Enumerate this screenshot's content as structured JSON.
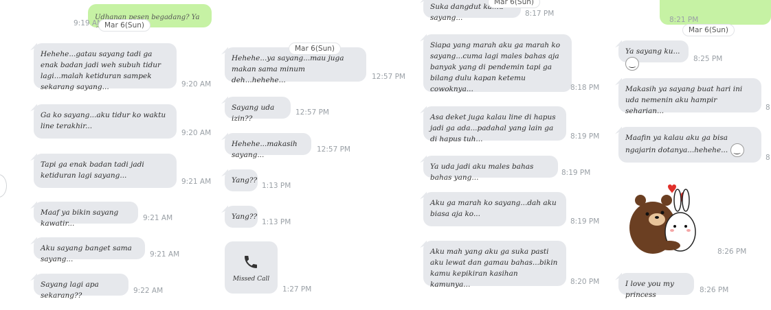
{
  "columns": [
    {
      "top_fragment": {
        "text": "Udhanan pesen begadang? Ya ga?",
        "time": "9:19 AM"
      },
      "date": "Mar 6(Sun)",
      "messages": [
        {
          "text": "Hehehe...gatau sayang tadi ga enak badan jadi weh subuh tidur lagi...malah ketiduran sampek sekarang sayang...",
          "time": "9:20 AM"
        },
        {
          "text": "Ga ko sayang...aku tidur ko waktu line terakhir...",
          "time": "9:20 AM"
        },
        {
          "text": "Tapi ga enak badan tadi jadi ketiduran lagi sayang...",
          "time": "9:21 AM"
        },
        {
          "text": "Maaf ya bikin sayang kawatir...",
          "time": "9:21 AM"
        },
        {
          "text": "Aku sayang banget sama sayang...",
          "time": "9:21 AM"
        },
        {
          "text": "Sayang lagi apa sekarang??",
          "time": "9:22 AM"
        }
      ]
    },
    {
      "date": "Mar 6(Sun)",
      "messages": [
        {
          "text": "Hehehe...ya sayang...mau juga makan sama minum deh...hehehe...",
          "time": "12:57 PM"
        },
        {
          "text": "Sayang uda izin??",
          "time": "12:57 PM"
        },
        {
          "text": "Hehehe...makasih sayang...",
          "time": "12:57 PM"
        },
        {
          "text": "Yang??",
          "time": "1:13 PM"
        },
        {
          "text": "Yang??",
          "time": "1:13 PM"
        }
      ],
      "missed_call": {
        "icon": "phone-icon",
        "label": "Missed Call",
        "time": "1:27 PM"
      }
    },
    {
      "date": "Mar 6(Sun)",
      "messages": [
        {
          "text": "Suka dangdut kamu sayang...",
          "time": "8:17 PM"
        },
        {
          "text": "Siapa yang marah aku ga marah ko sayang...cuma lagi males bahas aja banyak yang di pendemin tapi ga bilang dulu kapan ketemu cowoknya...",
          "time": "8:18 PM"
        },
        {
          "text": "Asa deket juga kalau line di hapus jadi ga ada...padahal yang lain ga di hapus tuh...",
          "time": "8:19 PM"
        },
        {
          "text": "Ya uda jadi aku males bahas bahas yang...",
          "time": "8:19 PM"
        },
        {
          "text": "Aku ga marah ko sayang...dah aku biasa aja ko...",
          "time": "8:19 PM"
        },
        {
          "text": "Aku mah yang aku ga suka pasti aku lewat dan gamau bahas...bikin kamu kepikiran kasihan kamunya...",
          "time": "8:20 PM"
        }
      ]
    },
    {
      "top_fragment": {
        "text": "",
        "time": "8:21 PM"
      },
      "date": "Mar 6(Sun)",
      "messages": [
        {
          "text": "Ya sayang ku...",
          "time": "8:25 PM",
          "emoji": "smile-emoticon-icon"
        },
        {
          "text": "Makasih ya sayang buat hari ini uda nemenin aku hampir seharian...",
          "time": "8"
        },
        {
          "text": "Maafin ya kalau aku ga bisa ngajarin dotanya...hehehe...",
          "time": "8",
          "emoji": "smile-emoticon-icon"
        },
        {
          "text": "I love you my princess",
          "time": "8:26 PM"
        }
      ],
      "sticker": {
        "icon": "bear-and-bunny-hug-sticker",
        "time": "8:26 PM"
      }
    }
  ],
  "colors": {
    "bubble": "#e6e8ec",
    "sent_bubble": "#c6f2a4",
    "time": "#9aa0a6"
  }
}
